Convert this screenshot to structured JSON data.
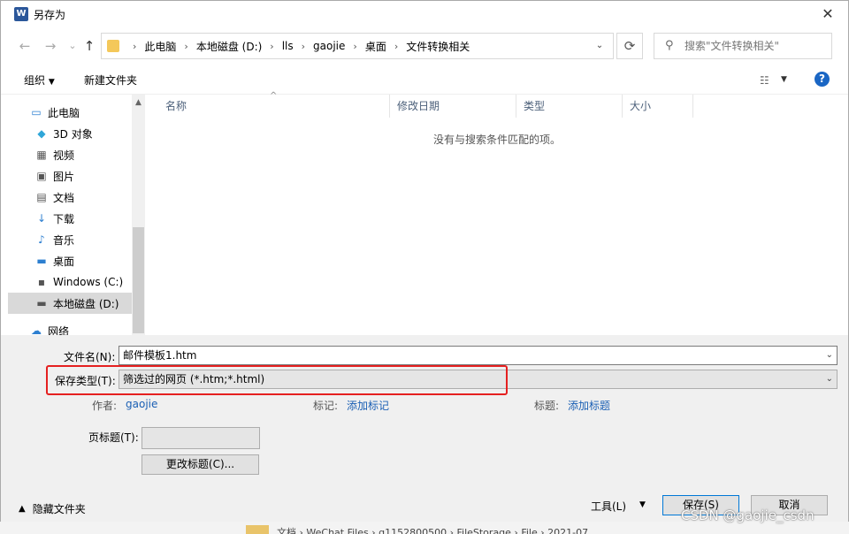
{
  "window": {
    "title": "另存为",
    "app_icon": "word-icon",
    "close": "✕"
  },
  "nav": {
    "back": "←",
    "forward": "→",
    "recent": "⌄",
    "up": "↑",
    "breadcrumbs": [
      "此电脑",
      "本地磁盘 (D:)",
      "lls",
      "gaojie",
      "桌面",
      "文件转换相关"
    ],
    "search_placeholder": "搜索\"文件转换相关\""
  },
  "toolbar": {
    "organize": "组织",
    "new_folder": "新建文件夹"
  },
  "sidebar": [
    {
      "label": "此电脑",
      "icon": "pc-icon"
    },
    {
      "label": "3D 对象",
      "icon": "cube-icon"
    },
    {
      "label": "视频",
      "icon": "video-icon"
    },
    {
      "label": "图片",
      "icon": "picture-icon"
    },
    {
      "label": "文档",
      "icon": "document-icon"
    },
    {
      "label": "下载",
      "icon": "download-icon"
    },
    {
      "label": "音乐",
      "icon": "music-icon"
    },
    {
      "label": "桌面",
      "icon": "desktop-icon"
    },
    {
      "label": "Windows (C:)",
      "icon": "drive-icon"
    },
    {
      "label": "本地磁盘 (D:)",
      "icon": "drive-icon",
      "selected": true
    },
    {
      "label": "网络",
      "icon": "network-icon"
    }
  ],
  "columns": [
    "名称",
    "修改日期",
    "类型",
    "大小"
  ],
  "empty_message": "没有与搜索条件匹配的项。",
  "form": {
    "filename_label": "文件名(N):",
    "filename_value": "邮件模板1.htm",
    "type_label": "保存类型(T):",
    "type_value": "筛选过的网页 (*.htm;*.html)",
    "author_label": "作者:",
    "author_value": "gaojie",
    "tags_label": "标记:",
    "tags_value": "添加标记",
    "title_label": "标题:",
    "title_value": "添加标题",
    "page_title_label": "页标题(T):",
    "page_title_value": "",
    "change_title_button": "更改标题(C)...",
    "tools_button": "工具(L)",
    "save_button": "保存(S)",
    "cancel_button": "取消",
    "hide_folders": "隐藏文件夹"
  },
  "background": {
    "path_text": "文档 › WeChat Files › q1152800500 › FileStorage › File › 2021-07"
  },
  "watermark": "CSDN @gaojie_csdn",
  "colors": {
    "highlight_border": "#e52020",
    "link": "#1a5fb4",
    "primary_button_border": "#0078d7"
  }
}
